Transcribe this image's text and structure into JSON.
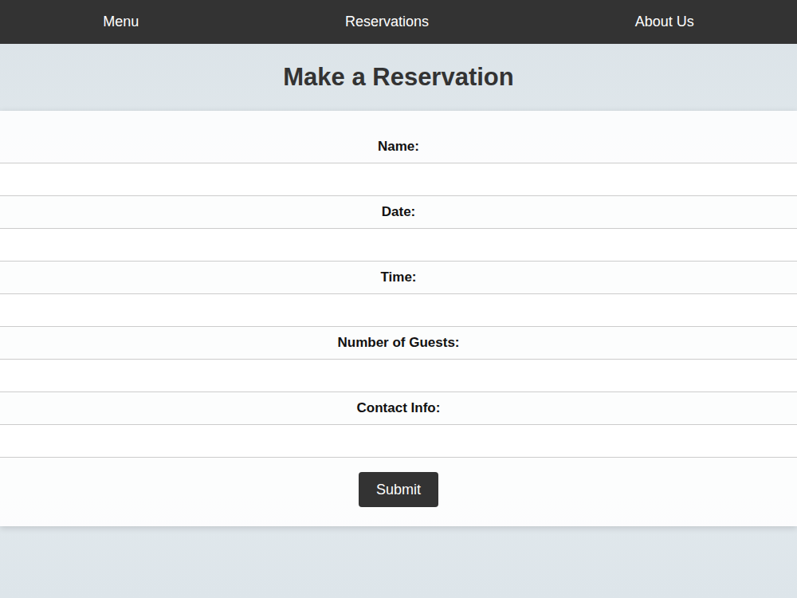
{
  "nav": {
    "items": [
      {
        "label": "Menu"
      },
      {
        "label": "Reservations"
      },
      {
        "label": "About Us"
      }
    ]
  },
  "page": {
    "title": "Make a Reservation"
  },
  "form": {
    "fields": [
      {
        "label": "Name:",
        "value": ""
      },
      {
        "label": "Date:",
        "value": ""
      },
      {
        "label": "Time:",
        "value": ""
      },
      {
        "label": "Number of Guests:",
        "value": ""
      },
      {
        "label": "Contact Info:",
        "value": ""
      }
    ],
    "submit": "Submit"
  }
}
